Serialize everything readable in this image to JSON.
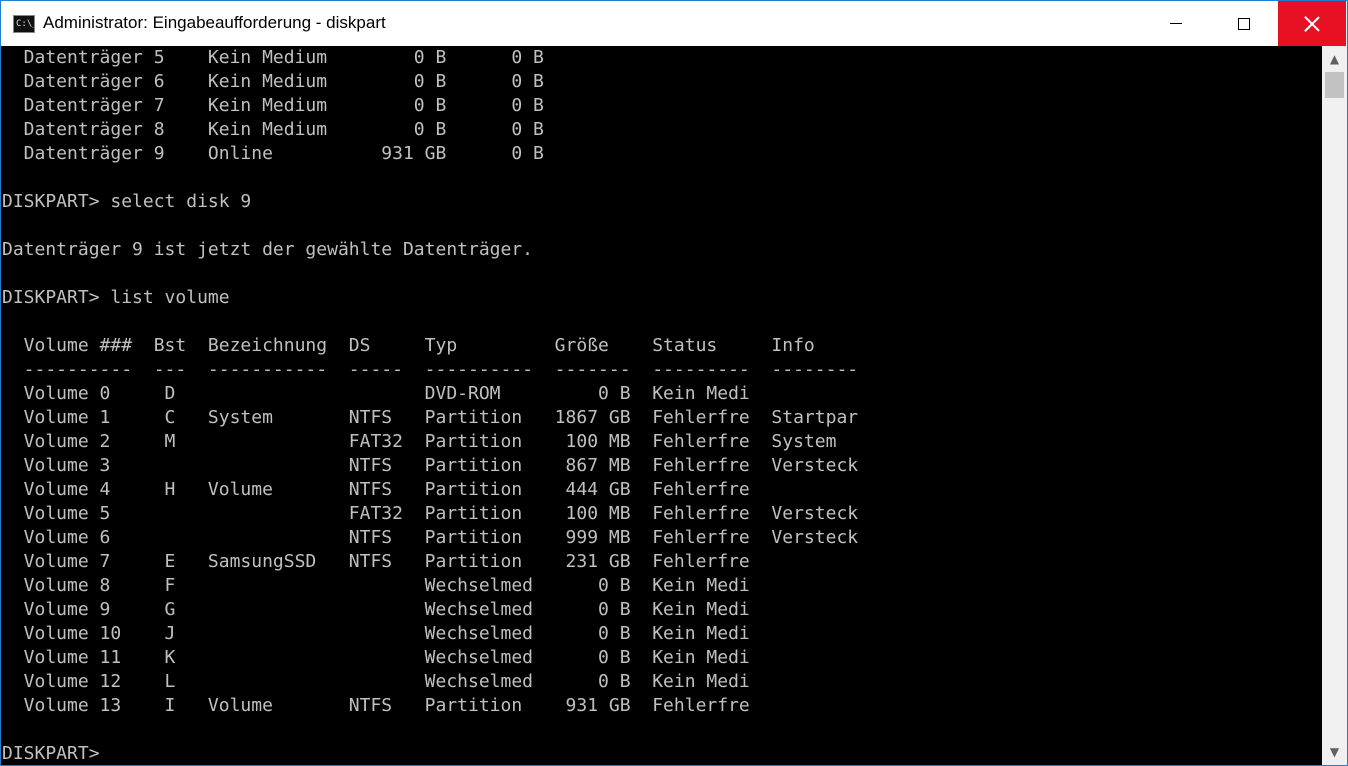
{
  "window": {
    "title": "Administrator: Eingabeaufforderung - diskpart",
    "icon_label": "C:\\_"
  },
  "controls": {
    "minimize": "minimize-icon",
    "maximize": "maximize-icon",
    "close": "close-icon",
    "close_color": "#e81123"
  },
  "console": {
    "lines": [
      "  Datenträger 5    Kein Medium        0 B      0 B",
      "  Datenträger 6    Kein Medium        0 B      0 B",
      "  Datenträger 7    Kein Medium        0 B      0 B",
      "  Datenträger 8    Kein Medium        0 B      0 B",
      "  Datenträger 9    Online          931 GB      0 B",
      "",
      "DISKPART> select disk 9",
      "",
      "Datenträger 9 ist jetzt der gewählte Datenträger.",
      "",
      "DISKPART> list volume",
      "",
      "  Volume ###  Bst  Bezeichnung  DS     Typ         Größe    Status     Info",
      "  ----------  ---  -----------  -----  ----------  -------  ---------  --------",
      "  Volume 0     D                       DVD-ROM         0 B  Kein Medi",
      "  Volume 1     C   System       NTFS   Partition   1867 GB  Fehlerfre  Startpar",
      "  Volume 2     M                FAT32  Partition    100 MB  Fehlerfre  System",
      "  Volume 3                      NTFS   Partition    867 MB  Fehlerfre  Versteck",
      "  Volume 4     H   Volume       NTFS   Partition    444 GB  Fehlerfre",
      "  Volume 5                      FAT32  Partition    100 MB  Fehlerfre  Versteck",
      "  Volume 6                      NTFS   Partition    999 MB  Fehlerfre  Versteck",
      "  Volume 7     E   SamsungSSD   NTFS   Partition    231 GB  Fehlerfre",
      "  Volume 8     F                       Wechselmed      0 B  Kein Medi",
      "  Volume 9     G                       Wechselmed      0 B  Kein Medi",
      "  Volume 10    J                       Wechselmed      0 B  Kein Medi",
      "  Volume 11    K                       Wechselmed      0 B  Kein Medi",
      "  Volume 12    L                       Wechselmed      0 B  Kein Medi",
      "  Volume 13    I   Volume       NTFS   Partition    931 GB  Fehlerfre",
      "",
      "DISKPART> "
    ]
  },
  "scrollbar": {
    "up_icon": "scroll-up-arrow-icon",
    "down_icon": "scroll-down-arrow-icon"
  }
}
